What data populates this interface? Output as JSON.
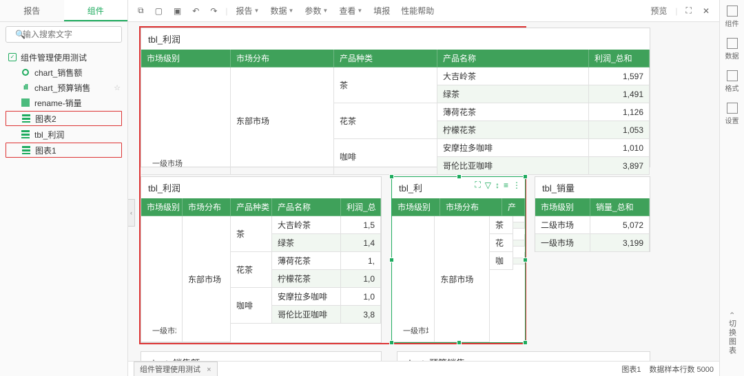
{
  "sideTabs": {
    "report": "报告",
    "component": "组件"
  },
  "search": {
    "placeholder": "输入搜索文字"
  },
  "tree": {
    "root": "组件管理使用测试",
    "items": [
      "chart_销售额",
      "chart_预算销售",
      "rename-销量",
      "图表2",
      "tbl_利润",
      "图表1"
    ]
  },
  "toolbar": {
    "menus": [
      "报告",
      "数据",
      "参数",
      "查看",
      "填报",
      "性能帮助"
    ],
    "preview": "预览"
  },
  "panels": {
    "p1": {
      "title": "tbl_利润",
      "headers": [
        "市场级别",
        "市场分布",
        "产品种类",
        "产品名称",
        "利润_总和"
      ],
      "lvl": "一级市场",
      "dist": "东部市场",
      "rows": [
        {
          "cat": "茶",
          "name": "大吉岭茶",
          "val": "1,597"
        },
        {
          "cat": "",
          "name": "绿茶",
          "val": "1,491"
        },
        {
          "cat": "花茶",
          "name": "薄荷花茶",
          "val": "1,126"
        },
        {
          "cat": "",
          "name": "柠檬花茶",
          "val": "1,053"
        },
        {
          "cat": "咖啡",
          "name": "安摩拉多咖啡",
          "val": "1,010"
        },
        {
          "cat": "",
          "name": "哥伦比亚咖啡",
          "val": "3,897"
        }
      ]
    },
    "p2": {
      "title": "tbl_利润",
      "headers": [
        "市场级别",
        "市场分布",
        "产品种类",
        "产品名称",
        "利润_总"
      ],
      "lvl": "一级市场",
      "dist": "东部市场",
      "rows": [
        {
          "cat": "茶",
          "name": "大吉岭茶",
          "val": "1,5"
        },
        {
          "cat": "",
          "name": "绿茶",
          "val": "1,4"
        },
        {
          "cat": "花茶",
          "name": "薄荷花茶",
          "val": "1,"
        },
        {
          "cat": "",
          "name": "柠檬花茶",
          "val": "1,0"
        },
        {
          "cat": "咖啡",
          "name": "安摩拉多咖啡",
          "val": "1,0"
        },
        {
          "cat": "",
          "name": "哥伦比亚咖啡",
          "val": "3,8"
        }
      ]
    },
    "p3": {
      "title": "tbl_利",
      "headers": [
        "市场级别",
        "市场分布",
        "产"
      ],
      "lvl": "一级市场",
      "dist": "东部市场",
      "rows": [
        {
          "cat": "茶"
        },
        {
          "cat": ""
        },
        {
          "cat": "花"
        },
        {
          "cat": ""
        },
        {
          "cat": "咖"
        },
        {
          "cat": ""
        }
      ]
    },
    "p4": {
      "title": "tbl_销量",
      "headers": [
        "市场级别",
        "销量_总和"
      ],
      "rows": [
        {
          "lvl": "二级市场",
          "val": "5,072"
        },
        {
          "lvl": "一级市场",
          "val": "3,199"
        }
      ]
    },
    "p5": {
      "title": "chart_销售额"
    },
    "p6": {
      "title": "chart_预算销售"
    }
  },
  "rightbar": {
    "items": [
      "组件",
      "数据",
      "格式",
      "设置"
    ],
    "switch": "切换图表"
  },
  "footer": {
    "tab": "组件管理使用测试",
    "chart": "图表1",
    "rows": "数据样本行数 5000"
  }
}
